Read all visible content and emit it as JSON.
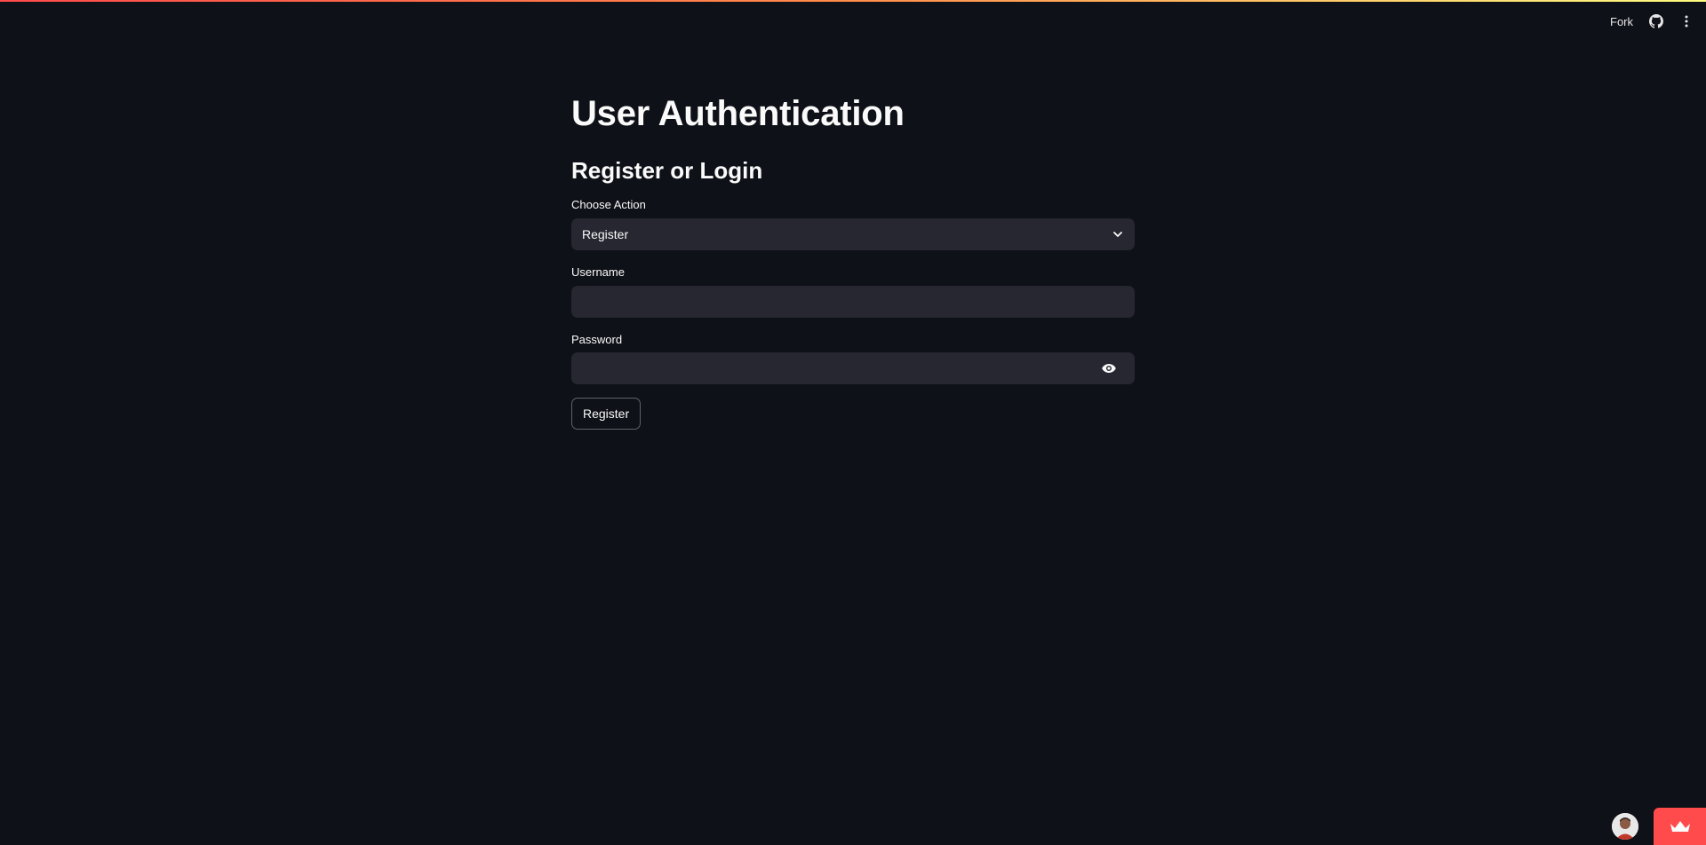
{
  "header": {
    "fork_label": "Fork",
    "icons": [
      "github-icon",
      "more-vertical-icon"
    ]
  },
  "main": {
    "title": "User Authentication",
    "subtitle": "Register or Login",
    "action_select": {
      "label": "Choose Action",
      "value": "Register"
    },
    "username": {
      "label": "Username",
      "value": ""
    },
    "password": {
      "label": "Password",
      "value": ""
    },
    "submit_label": "Register"
  },
  "footer": {
    "icons": [
      "avatar",
      "crown-icon"
    ]
  },
  "colors": {
    "background": "#0e1117",
    "input_bg": "#262730",
    "accent": "#ff4b4b",
    "text": "#fafafa"
  }
}
